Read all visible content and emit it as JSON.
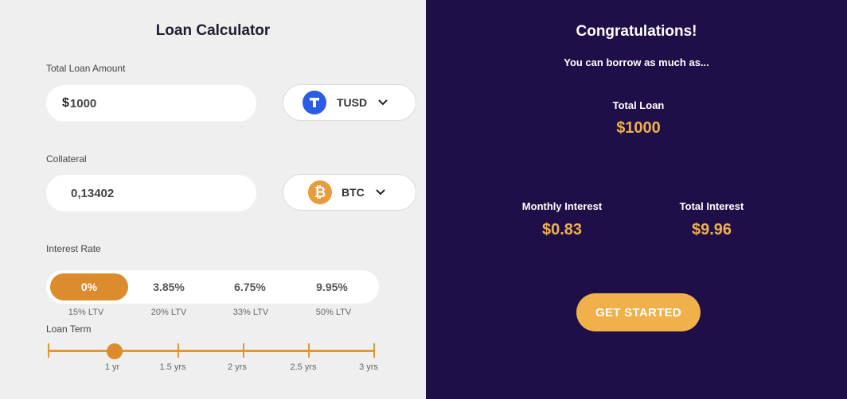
{
  "calculator": {
    "title": "Loan Calculator",
    "loan_amount": {
      "label": "Total Loan Amount",
      "currency_symbol": "$",
      "value": "1000"
    },
    "loan_currency": {
      "symbol": "TUSD",
      "icon": "tusd-icon",
      "color": "#2b5ce6"
    },
    "collateral": {
      "label": "Collateral",
      "value": "0,13402"
    },
    "collateral_currency": {
      "symbol": "BTC",
      "icon": "bitcoin-icon",
      "color": "#e89a3c"
    },
    "interest_rate": {
      "label": "Interest Rate",
      "options": [
        {
          "rate": "0%",
          "ltv": "15% LTV",
          "selected": true
        },
        {
          "rate": "3.85%",
          "ltv": "20% LTV",
          "selected": false
        },
        {
          "rate": "6.75%",
          "ltv": "33% LTV",
          "selected": false
        },
        {
          "rate": "9.95%",
          "ltv": "50% LTV",
          "selected": false
        }
      ]
    },
    "loan_term": {
      "label": "Loan Term",
      "ticks": [
        "1 yr",
        "1.5 yrs",
        "2 yrs",
        "2.5 yrs",
        "3 yrs"
      ],
      "selected": "1 yr"
    }
  },
  "result": {
    "title": "Congratulations!",
    "subtitle": "You can borrow as much as...",
    "total_loan": {
      "label": "Total Loan",
      "value": "$1000"
    },
    "monthly_interest": {
      "label": "Monthly Interest",
      "value": "$0.83"
    },
    "total_interest": {
      "label": "Total Interest",
      "value": "$9.96"
    },
    "cta_label": "GET STARTED"
  },
  "colors": {
    "accent": "#f0b04a",
    "active_rate": "#dc8c2c",
    "panel_bg": "#1f0f48",
    "page_bg": "#efefef"
  }
}
